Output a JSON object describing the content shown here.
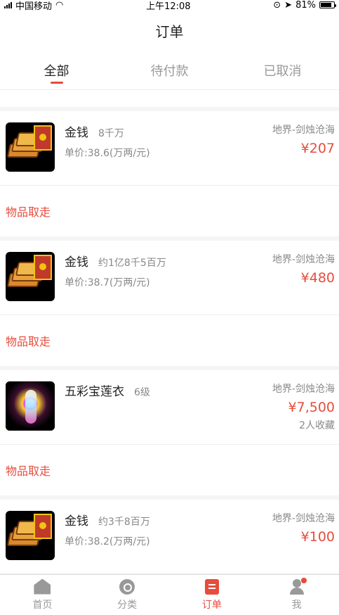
{
  "status_bar": {
    "carrier": "中国移动",
    "time": "上午12:08",
    "battery": "81%",
    "icons": [
      "signal-icon",
      "wifi-icon",
      "rotation-lock-icon",
      "location-icon",
      "battery-icon"
    ]
  },
  "header": {
    "title": "订单"
  },
  "tabs": [
    {
      "label": "全部",
      "active": true
    },
    {
      "label": "待付款",
      "active": false
    },
    {
      "label": "已取消",
      "active": false
    }
  ],
  "orders": [
    {
      "name": "金钱",
      "qty": "8千万",
      "unit_price": "单价:38.6(万两/元)",
      "server": "地界-剑烛沧海",
      "price": "¥207",
      "favorites": "",
      "action": "物品取走",
      "icon": "gold-ingot-icon"
    },
    {
      "name": "金钱",
      "qty": "约1亿8千5百万",
      "unit_price": "单价:38.7(万两/元)",
      "server": "地界-剑烛沧海",
      "price": "¥480",
      "favorites": "",
      "action": "物品取走",
      "icon": "gold-ingot-icon"
    },
    {
      "name": "五彩宝莲衣",
      "qty": "6级",
      "unit_price": "",
      "server": "地界-剑烛沧海",
      "price": "¥7,500",
      "favorites": "2人收藏",
      "action": "物品取走",
      "icon": "robe-icon"
    },
    {
      "name": "金钱",
      "qty": "约3千8百万",
      "unit_price": "单价:38.2(万两/元)",
      "server": "地界-剑烛沧海",
      "price": "¥100",
      "favorites": "",
      "action": "",
      "icon": "gold-ingot-icon"
    }
  ],
  "tabbar": [
    {
      "label": "首页",
      "icon": "home-icon",
      "active": false
    },
    {
      "label": "分类",
      "icon": "category-icon",
      "active": false
    },
    {
      "label": "订单",
      "icon": "orders-icon",
      "active": true
    },
    {
      "label": "我",
      "icon": "profile-icon",
      "active": false
    }
  ],
  "colors": {
    "accent": "#e74c3c",
    "muted": "#888888",
    "background": "#f5f5f5"
  }
}
